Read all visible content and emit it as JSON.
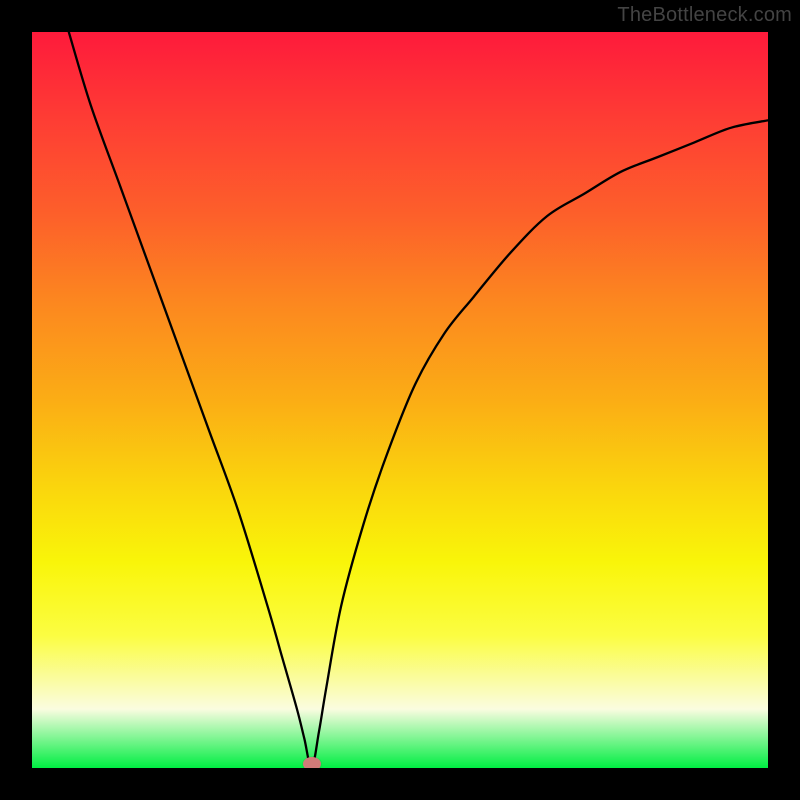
{
  "watermark": "TheBottleneck.com",
  "colors": {
    "frame_bg": "#000000",
    "curve": "#000000",
    "marker": "#d07b78"
  },
  "chart_data": {
    "type": "line",
    "title": "",
    "xlabel": "",
    "ylabel": "",
    "xlim": [
      0,
      100
    ],
    "ylim": [
      0,
      100
    ],
    "grid": false,
    "legend_position": "none",
    "minimum": {
      "x": 38,
      "y": 0
    },
    "series": [
      {
        "name": "bottleneck-curve",
        "x": [
          5,
          8,
          12,
          16,
          20,
          24,
          28,
          32,
          34,
          36,
          37,
          38,
          39,
          40,
          42,
          45,
          48,
          52,
          56,
          60,
          65,
          70,
          75,
          80,
          85,
          90,
          95,
          100
        ],
        "values": [
          100,
          90,
          79,
          68,
          57,
          46,
          35,
          22,
          15,
          8,
          4,
          0,
          5,
          11,
          22,
          33,
          42,
          52,
          59,
          64,
          70,
          75,
          78,
          81,
          83,
          85,
          87,
          88
        ]
      }
    ],
    "gradient_stops": [
      {
        "pos": 0.0,
        "color": "#fe1a3b"
      },
      {
        "pos": 0.12,
        "color": "#fe3d34"
      },
      {
        "pos": 0.25,
        "color": "#fd602a"
      },
      {
        "pos": 0.37,
        "color": "#fc881f"
      },
      {
        "pos": 0.5,
        "color": "#fbad15"
      },
      {
        "pos": 0.62,
        "color": "#fad60d"
      },
      {
        "pos": 0.72,
        "color": "#f9f509"
      },
      {
        "pos": 0.82,
        "color": "#fbfd42"
      },
      {
        "pos": 0.92,
        "color": "#fafce0"
      },
      {
        "pos": 1.0,
        "color": "#00ee42"
      }
    ]
  }
}
